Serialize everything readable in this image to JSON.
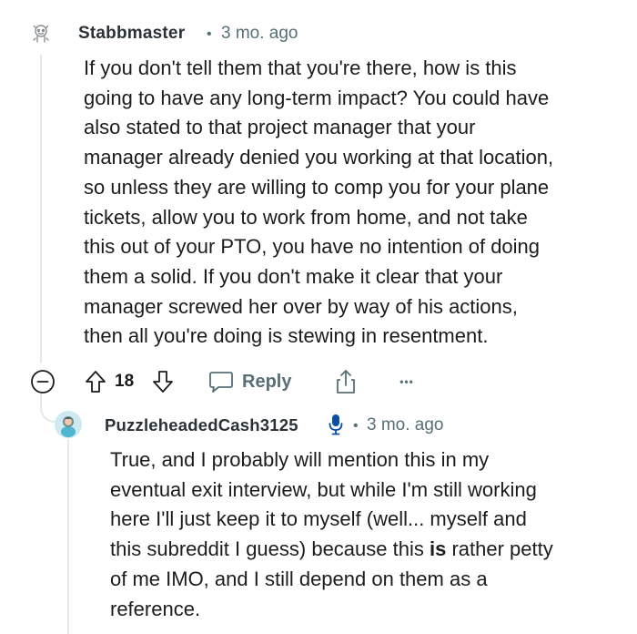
{
  "comment": {
    "author": "Stabbmaster",
    "separator": "•",
    "time": "3 mo. ago",
    "body_lines": [
      "If you don't tell them that you're there, how is this",
      "going to have any long-term impact? You could have",
      "also stated to that project manager that your",
      "manager already denied you working at that location,",
      "so unless they are willing to comp you for your plane",
      "tickets, allow you to work from home, and not take",
      "this out of your PTO, you have no intention of doing",
      "them a solid. If you don't make it clear that your",
      "manager screwed her over by way of his actions,",
      "then all you're doing is stewing in resentment."
    ],
    "actions": {
      "vote_count": "18",
      "reply_label": "Reply",
      "more_label": "•••"
    }
  },
  "reply": {
    "author": "PuzzleheadedCash3125",
    "separator": "•",
    "time": "3 mo. ago",
    "body_lines": [
      "True, and I probably will mention this in my",
      "eventual exit interview, but while I'm still working",
      "here I'll just keep it to myself (well... myself and"
    ],
    "line4_before": "this subreddit I guess) because this ",
    "line4_bold": "is",
    "line4_after": " rather petty",
    "body_lines_end": [
      "of me IMO, and I still depend on them as a",
      "reference."
    ]
  },
  "colors": {
    "meta": "#576f76",
    "text": "#1c1c1c",
    "thread_line": "#e5e7e9",
    "mic_blue": "#0a4fa8"
  },
  "icons": [
    "snoo-avatar-icon",
    "collapse-icon",
    "upvote-icon",
    "downvote-icon",
    "reply-bubble-icon",
    "share-icon",
    "more-icon",
    "user-avatar-icon",
    "microphone-icon"
  ]
}
